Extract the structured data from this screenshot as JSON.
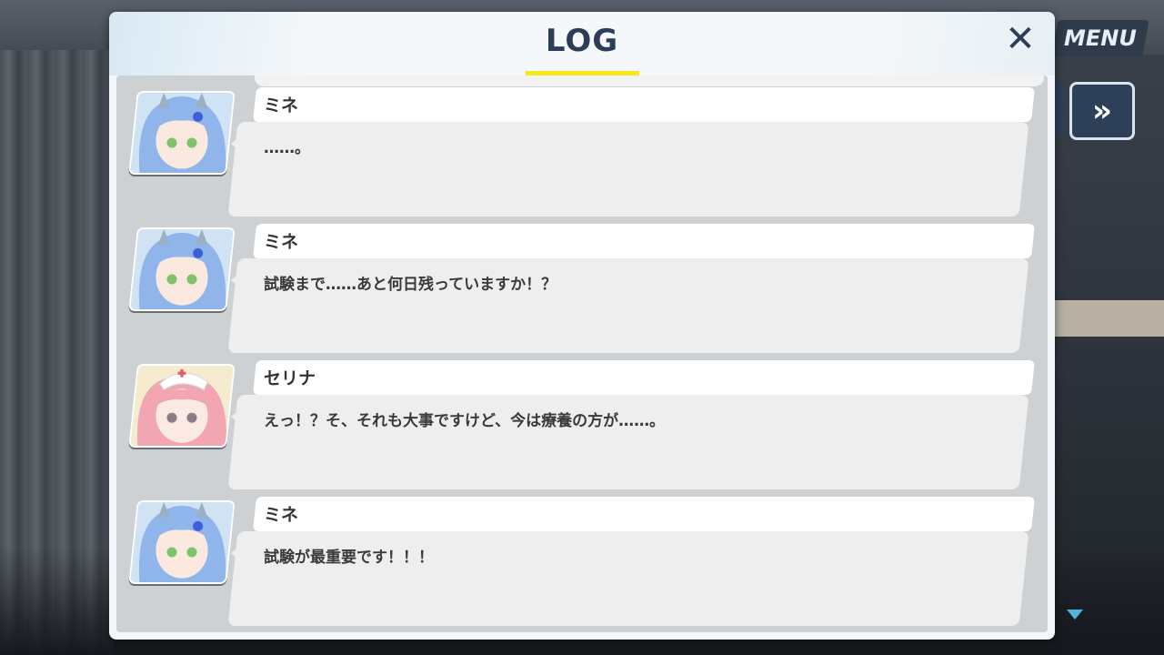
{
  "window": {
    "title": "LOG",
    "close_glyph": "✕"
  },
  "hud": {
    "menu_label": "MENU",
    "fast_forward_icon": "»",
    "scroll_down_icon": "▼"
  },
  "log": [
    {
      "speaker": "ミネ",
      "text": "……。",
      "avatar": "mine-portrait"
    },
    {
      "speaker": "ミネ",
      "text": "試験まで……あと何日残っていますか！？",
      "avatar": "mine-portrait"
    },
    {
      "speaker": "セリナ",
      "text": "えっ！？そ、それも大事ですけど、今は療養の方が……。",
      "avatar": "serina-portrait"
    },
    {
      "speaker": "ミネ",
      "text": "試験が最重要です！！！",
      "avatar": "mine-portrait"
    }
  ],
  "colors": {
    "title": "#2c3e57",
    "underline": "#f6e81c",
    "mine_hair": "#8fb5ea",
    "serina_hair": "#f2a6b2"
  }
}
